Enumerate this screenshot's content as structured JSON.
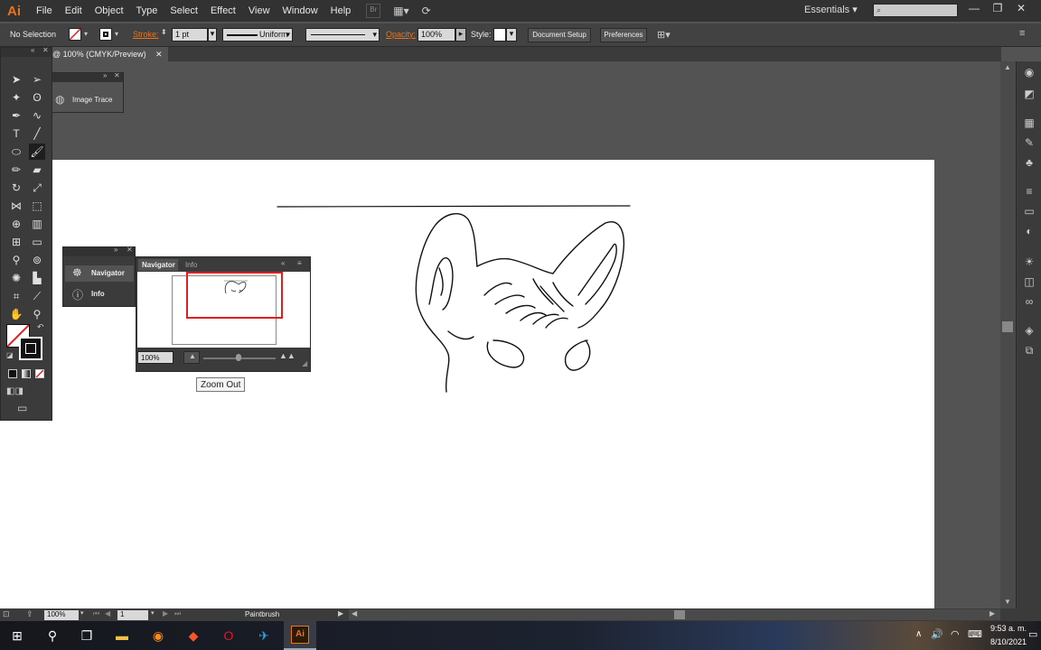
{
  "app": {
    "logo": "Ai"
  },
  "menu": [
    "File",
    "Edit",
    "Object",
    "Type",
    "Select",
    "Effect",
    "View",
    "Window",
    "Help"
  ],
  "menu_extra": {
    "bridge": "Br"
  },
  "workspace": {
    "label": "Essentials",
    "arrow": "▾"
  },
  "window_controls": {
    "minimize": "—",
    "restore": "❐",
    "close": "✕"
  },
  "control_bar": {
    "selection": "No Selection",
    "stroke_label": "Stroke:",
    "stroke_weight": "1 pt",
    "profile": "Uniform",
    "opacity_label": "Opacity:",
    "opacity_value": "100%",
    "style_label": "Style:",
    "document_setup": "Document Setup",
    "preferences": "Preferences"
  },
  "document_tab": {
    "title": "@ 100% (CMYK/Preview)",
    "close": "✕"
  },
  "image_trace_panel": {
    "label": "Image Trace"
  },
  "side_panel": {
    "items": [
      {
        "label": "Navigator"
      },
      {
        "label": "Info"
      }
    ]
  },
  "navigator_panel": {
    "tabs": [
      "Navigator",
      "Info"
    ],
    "zoom_value": "100%"
  },
  "tooltip": "Zoom Out",
  "status_bar": {
    "zoom": "100%",
    "artboard": "1",
    "tool": "Paintbrush"
  },
  "taskbar": {
    "time": "9:53 a. m.",
    "date": "8/10/2021",
    "apps": [
      "windows-start",
      "search",
      "task-view",
      "file-explorer",
      "firefox",
      "brave",
      "opera",
      "telegram",
      "illustrator"
    ],
    "illustrator_label": "Ai"
  },
  "colors": {
    "app_orange": "#e8741e",
    "ui_dark": "#323232",
    "ui_mid": "#535353",
    "artboard": "#ffffff",
    "navigator_view_box": "#e02020"
  }
}
